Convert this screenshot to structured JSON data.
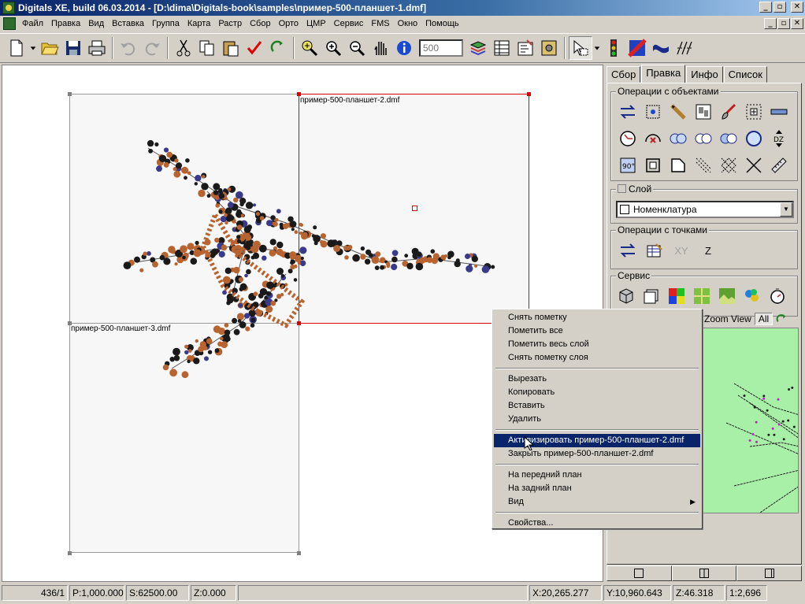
{
  "window": {
    "title": "Digitals XE, build 06.03.2014 - [D:\\dima\\Digitals-book\\samples\\пример-500-планшет-1.dmf]",
    "minimize": "_",
    "restore": "▫",
    "close": "✕"
  },
  "menu": {
    "items": [
      "Файл",
      "Правка",
      "Вид",
      "Вставка",
      "Группа",
      "Карта",
      "Растр",
      "Сбор",
      "Орто",
      "ЦМР",
      "Сервис",
      "FMS",
      "Окно",
      "Помощь"
    ]
  },
  "toolbar": {
    "scale_placeholder": "500",
    "icons": [
      "new-document-icon",
      "open-folder-icon",
      "save-icon",
      "print-icon",
      "undo-icon",
      "redo-icon",
      "cut-icon",
      "copy-icon",
      "paste-icon",
      "checkmark-icon",
      "refresh-icon",
      "zoom-window-icon",
      "zoom-in-icon",
      "zoom-out-icon",
      "pan-hand-icon",
      "info-icon",
      "layers-icon",
      "table-icon",
      "properties-icon",
      "settings-icon",
      "select-cursor-icon",
      "traffic-light-icon",
      "raster-icon",
      "wave-icon",
      "vector-icon"
    ]
  },
  "canvas": {
    "sheets": [
      {
        "label": ""
      },
      {
        "label": "пример-500-планшет-2.dmf"
      },
      {
        "label": "пример-500-планшет-3.dmf"
      }
    ]
  },
  "context_menu": {
    "groups": [
      [
        "Снять пометку",
        "Пометить все",
        "Пометить весь слой",
        "Снять пометку слоя"
      ],
      [
        "Вырезать",
        "Копировать",
        "Вставить",
        "Удалить"
      ],
      [
        "Активизировать пример-500-планшет-2.dmf",
        "Закрыть пример-500-планшет-2.dmf"
      ],
      [
        "На передний план",
        "На задний план",
        "Вид"
      ],
      [
        "Свойства..."
      ]
    ],
    "active_item": "Активизировать пример-500-планшет-2.dmf",
    "submenu_item": "Вид",
    "submenu_arrow": "▶"
  },
  "panel": {
    "tabs": [
      "Сбор",
      "Правка",
      "Инфо",
      "Список"
    ],
    "active_tab": "Правка",
    "object_ops_title": "Операции с объектами",
    "layer_title": "Слой",
    "layer_value": "Номенклатура",
    "layer_dropdown": "▼",
    "point_ops_title": "Операции с точками",
    "point_ops_xy": "XY",
    "point_ops_z": "Z",
    "service_title": "Сервис",
    "zoom_view": "Zoom View",
    "zoom_all": "All"
  },
  "statusbar": {
    "count": "436/1",
    "p": "P:1,000.000",
    "s": "S:62500.00",
    "z": "Z:0.000",
    "x": "X:20,265.277",
    "y": "Y:10,960.643",
    "z2": "Z:46.318",
    "scale": "1:2,696"
  },
  "colors": {
    "title_start": "#0a246a",
    "selection": "#0a246a",
    "minimap_bg": "#a8f0a8",
    "active_sheet_border": "#e00000",
    "feature_brown": "#b86430",
    "feature_dark": "#1a1a1a"
  }
}
